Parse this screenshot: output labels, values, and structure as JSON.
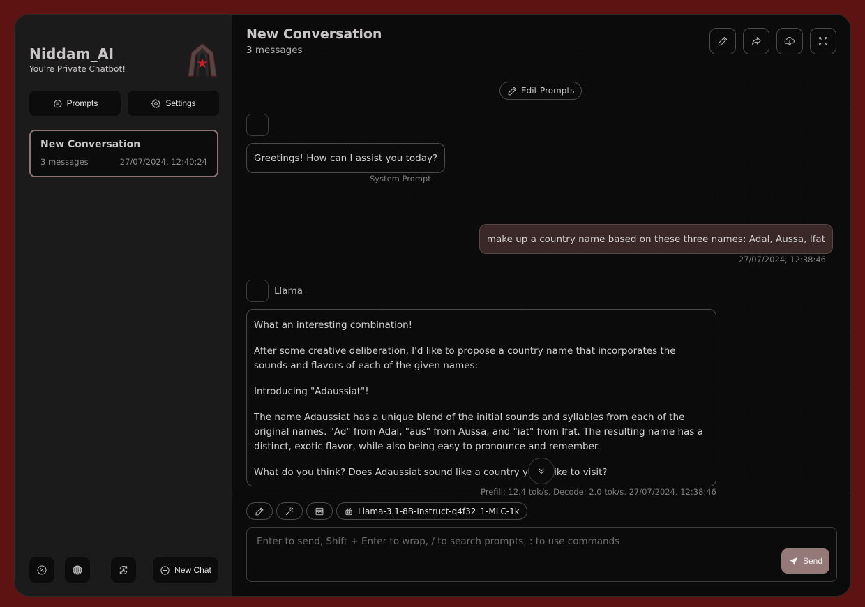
{
  "sidebar": {
    "brand_title": "Niddam_AI",
    "brand_subtitle": "You're Private Chatbot!",
    "prompts_label": "Prompts",
    "settings_label": "Settings",
    "conversations": [
      {
        "title": "New Conversation",
        "count": "3 messages",
        "timestamp": "27/07/2024, 12:40:24"
      }
    ],
    "bottom_icons": [
      "percent-circle-icon",
      "globe-icon",
      "refresh-a-icon"
    ],
    "new_chat_label": "New Chat"
  },
  "header": {
    "title": "New Conversation",
    "subtitle": "3 messages",
    "actions": [
      "edit-icon",
      "share-icon",
      "cloud-download-icon",
      "fullscreen-icon"
    ]
  },
  "chat": {
    "edit_prompts_label": "Edit Prompts",
    "messages": [
      {
        "role": "system",
        "text": "Greetings! How can I assist you today?",
        "meta": "System Prompt"
      },
      {
        "role": "user",
        "text": "make up a country name based on these three names: Adal, Aussa, Ifat",
        "meta": "27/07/2024, 12:38:46"
      },
      {
        "role": "assistant",
        "name": "Llama",
        "paragraphs": [
          "What an interesting combination!",
          "After some creative deliberation, I'd like to propose a country name that incorporates the sounds and flavors of each of the given names:",
          "Introducing \"Adaussiat\"!",
          "The name Adaussiat has a unique blend of the initial sounds and syllables from each of the original names. \"Ad\" from Adal, \"aus\" from Aussa, and \"iat\" from Ifat. The resulting name has a distinct, exotic flavor, while also being easy to pronounce and remember.",
          "What do you think? Does Adaussiat sound like a country you'd like to visit?"
        ],
        "meta": "Prefill: 12.4 tok/s, Decode: 2.0 tok/s, 27/07/2024, 12:38:46"
      }
    ]
  },
  "composer": {
    "tools": [
      "pencil-icon",
      "magic-wand-icon",
      "image-icon"
    ],
    "model": "Llama-3.1-8B-Instruct-q4f32_1-MLC-1k",
    "placeholder": "Enter to send, Shift + Enter to wrap, / to search prompts, : to use commands",
    "value": "",
    "send_label": "Send"
  },
  "colors": {
    "background": "#5e1313",
    "sidebar": "#1c1b1c",
    "main": "#0b0b0b",
    "accent": "#957979",
    "user_bubble": "#3a2828",
    "active_border": "#8e7474"
  }
}
